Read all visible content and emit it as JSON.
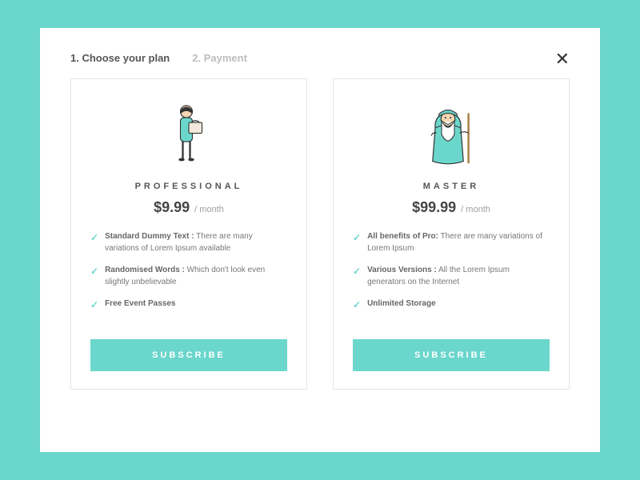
{
  "steps": {
    "step1": "1. Choose your plan",
    "step2": "2. Payment"
  },
  "close_glyph": "✕",
  "plans": [
    {
      "name": "PROFESSIONAL",
      "price": "$9.99",
      "period": "/ month",
      "features": [
        {
          "title": "Standard Dummy Text :",
          "desc": "  There are many variations of Lorem Ipsum available"
        },
        {
          "title": "Randomised Words :",
          "desc": "  Which don't look even slightly unbelievable"
        },
        {
          "title": "Free Event Passes",
          "desc": ""
        }
      ],
      "cta": "SUBSCRIBE"
    },
    {
      "name": "MASTER",
      "price": "$99.99",
      "period": "/ month",
      "features": [
        {
          "title": "All benefits of Pro:",
          "desc": " There are many variations of Lorem Ipsum"
        },
        {
          "title": "Various Versions :",
          "desc": " All the Lorem Ipsum generators on the Internet"
        },
        {
          "title": "Unlimited Storage",
          "desc": ""
        }
      ],
      "cta": "SUBSCRIBE"
    }
  ],
  "check_glyph": "✓"
}
